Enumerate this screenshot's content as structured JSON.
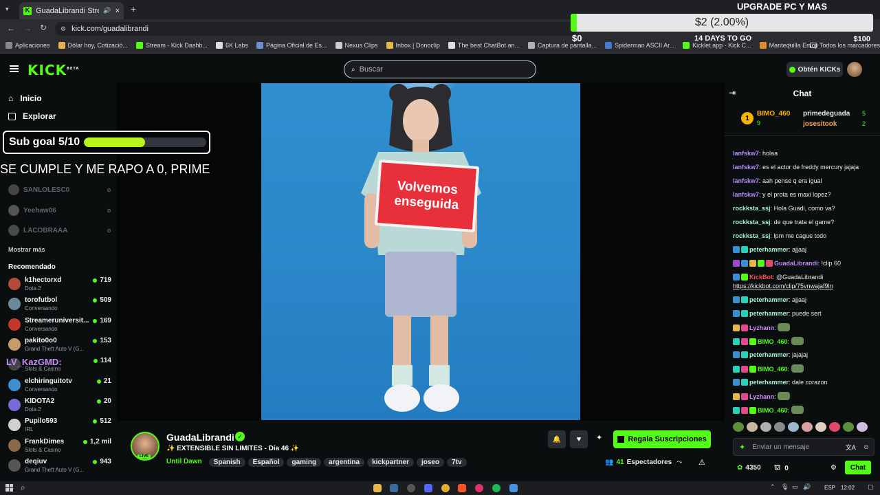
{
  "browser": {
    "tab_title": "GuadaLibrandi Stream - Wa",
    "url": "kick.com/guadalibrandi",
    "bookmarks": [
      "Aplicaciones",
      "Dólar hoy, Cotizació...",
      "Stream - Kick Dashb...",
      "6K Labs",
      "Página Oficial de Es...",
      "Nexus Clips",
      "Inbox | Donoclip",
      "The best ChatBot an...",
      "Captura de pantalla...",
      "Spiderman ASCII Ar...",
      "Kicklet.app - Kick C...",
      "Mantequilla Emoji"
    ],
    "bookmarks_folder": "Todos los marcadores"
  },
  "donation": {
    "title": "UPGRADE PC Y MAS",
    "amount": "$2 (2.00%)",
    "progress": 0.02,
    "min": "$0",
    "max": "$100",
    "days": "14 DAYS TO GO"
  },
  "header": {
    "logo": "KICK",
    "logo_sup": "BETA",
    "search_placeholder": "Buscar",
    "get_kicks": "Obtén KICKs"
  },
  "sidebar": {
    "nav": [
      "Inicio",
      "Explorar"
    ],
    "offline": [
      "SANLOLESC0",
      "Yeehaw06",
      "LACOBRAAA"
    ],
    "show_more": "Mostrar más",
    "recommended_title": "Recomendado",
    "recommended": [
      {
        "name": "k1hectorxd",
        "category": "Dota 2",
        "viewers": "719",
        "color": "#b34a3a"
      },
      {
        "name": "torofutbol",
        "category": "Conversando",
        "viewers": "509",
        "color": "#6a8a9a"
      },
      {
        "name": "Streameruniversit...",
        "category": "Conversando",
        "viewers": "169",
        "color": "#c0392b"
      },
      {
        "name": "pakito0o0",
        "category": "Grand Theft Auto V (G...",
        "viewers": "153",
        "color": "#c89b6a"
      },
      {
        "name": "",
        "category": "Slots & Casino",
        "viewers": "114",
        "color": "#444"
      },
      {
        "name": "elchiringuitotv",
        "category": "Conversando",
        "viewers": "21",
        "color": "#3a8fd0"
      },
      {
        "name": "KIDOTA2",
        "category": "Dota 2",
        "viewers": "20",
        "color": "#7a6ad8"
      },
      {
        "name": "Pupilo593",
        "category": "IRL",
        "viewers": "512",
        "color": "#d0d0d0"
      },
      {
        "name": "FrankDimes",
        "category": "Slots & Casino",
        "viewers": "1,2 mil",
        "color": "#8a6a4a"
      },
      {
        "name": "deqiuv",
        "category": "Grand Theft Auto V (G...",
        "viewers": "943",
        "color": "#555"
      }
    ]
  },
  "overlay": {
    "subgoal": "Sub goal 5/10",
    "subgoal_progress": 0.5,
    "ticker": "SE CUMPLE Y ME RAPO A 0, PRIME",
    "chat_name": "LV_KazGMD:",
    "sign_line1": "Volvemos",
    "sign_line2": "enseguida"
  },
  "stream": {
    "streamer": "GuadaLibrandi",
    "title": "✨ EXTENSIBLE SIN LIMITES - Día 46 ✨",
    "category": "Until Dawn",
    "tags": [
      "Spanish",
      "Español",
      "gaming",
      "argentina",
      "kickpartner",
      "joseo",
      "7tv"
    ],
    "live": "LIVE",
    "gift_button": "Regala Suscripciones",
    "viewers": "41",
    "viewers_label": "Espectadores"
  },
  "chat": {
    "title": "Chat",
    "top_gifter": {
      "name": "BIMO_460",
      "count": "9",
      "rank": "1"
    },
    "top2": {
      "name": "primedeguada",
      "count": "5"
    },
    "top3": {
      "name": "josesitook",
      "count": "2"
    },
    "messages": [
      {
        "user": "lanfskw7",
        "text": "holaa",
        "color": "#b48cff"
      },
      {
        "user": "lanfskw7",
        "text": "es el actor de freddy mercury jajaja",
        "color": "#b48cff"
      },
      {
        "user": "lanfskw7",
        "text": "aah pense q era igual",
        "color": "#b48cff"
      },
      {
        "user": "lanfskw7",
        "text": "y el prota es maxi lopez?",
        "color": "#b48cff"
      },
      {
        "user": "rockksta_ssj",
        "text": "Hola Guadi, como va?",
        "color": "#a9f5d8"
      },
      {
        "user": "rockksta_ssj",
        "text": "de que trata el game?",
        "color": "#a9f5d8"
      },
      {
        "user": "rockksta_ssj",
        "text": "lpm me cague todo",
        "color": "#a9f5d8"
      },
      {
        "user": "peterhammer",
        "text": "ajjaaj",
        "color": "#a9f5d8"
      },
      {
        "user": "GuadaLibrandi",
        "text": "!clip 60",
        "color": "#c58cff"
      },
      {
        "user": "KickBot",
        "text": "@GuadaLibrandi",
        "color": "#ff4d4d"
      },
      {
        "user": "",
        "text": "https://kickbot.com/clip/75vnwajaf9ln",
        "color": "#ffffff"
      },
      {
        "user": "peterhammer",
        "text": "ajjaaj",
        "color": "#a9f5d8"
      },
      {
        "user": "peterhammer",
        "text": "puede sert",
        "color": "#a9f5d8"
      },
      {
        "user": "Lyzhann",
        "text": "",
        "color": "#d58cff"
      },
      {
        "user": "BIMO_460",
        "text": "",
        "color": "#53fc18"
      },
      {
        "user": "peterhammer",
        "text": "jajajaj",
        "color": "#a9f5d8"
      },
      {
        "user": "BIMO_460",
        "text": "",
        "color": "#53fc18"
      },
      {
        "user": "peterhammer",
        "text": "dale corazon",
        "color": "#a9f5d8"
      },
      {
        "user": "Lyzhann",
        "text": "",
        "color": "#d58cff"
      },
      {
        "user": "BIMO_460",
        "text": "",
        "color": "#53fc18"
      }
    ],
    "input_placeholder": "Enviar un mensaje",
    "kicks_balance": "4350",
    "points": "0",
    "send_button": "Chat"
  },
  "taskbar": {
    "lang": "ESP",
    "time": "12:02"
  },
  "colors": {
    "kick_green": "#53fc18",
    "bg": "#0b0e0f"
  }
}
